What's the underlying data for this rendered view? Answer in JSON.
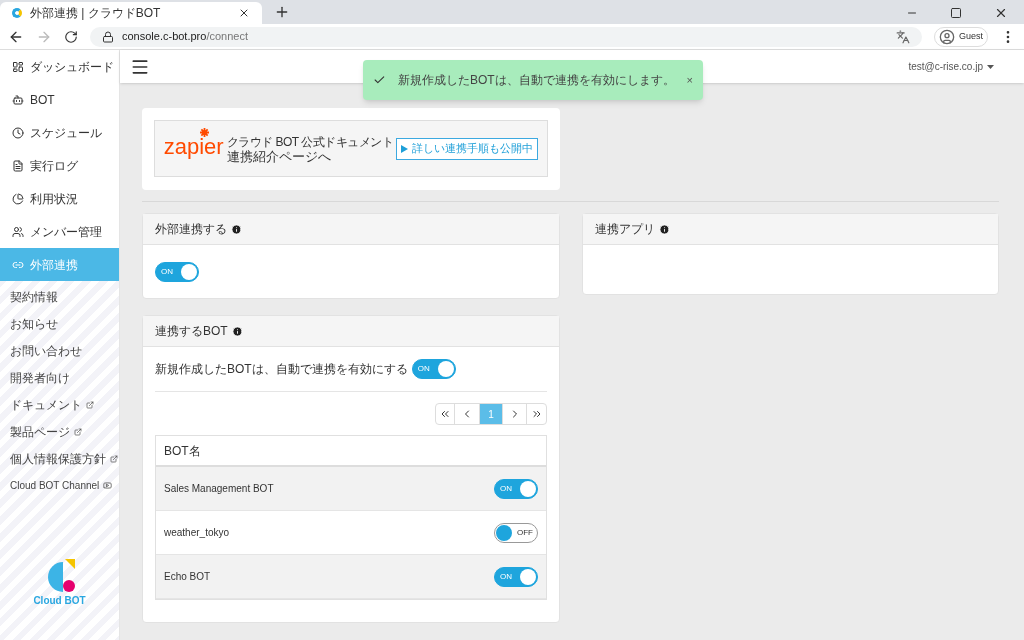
{
  "browser": {
    "tab_title": "外部連携 | クラウドBOT",
    "url_host": "console.c-bot.pro",
    "url_path": "/connect",
    "profile": "Guest"
  },
  "sidebar": {
    "items": [
      {
        "label": "ダッシュボード",
        "selected": false
      },
      {
        "label": "BOT",
        "selected": false
      },
      {
        "label": "スケジュール",
        "selected": false
      },
      {
        "label": "実行ログ",
        "selected": false
      },
      {
        "label": "利用状況",
        "selected": false
      },
      {
        "label": "メンバー管理",
        "selected": false
      },
      {
        "label": "外部連携",
        "selected": true
      }
    ],
    "links": [
      {
        "label": "契約情報",
        "kind": "plain"
      },
      {
        "label": "お知らせ",
        "kind": "plain"
      },
      {
        "label": "お問い合わせ",
        "kind": "plain"
      },
      {
        "label": "開発者向け",
        "kind": "plain"
      },
      {
        "label": "ドキュメント",
        "kind": "external"
      },
      {
        "label": "製品ページ",
        "kind": "external"
      },
      {
        "label": "個人情報保護方針",
        "kind": "external"
      },
      {
        "label": "Cloud BOT Channel",
        "kind": "video"
      }
    ],
    "logo_text": "Cloud BOT"
  },
  "topbar": {
    "user": "test@c-rise.co.jp"
  },
  "toast": {
    "message": "新規作成したBOTは、自動で連携を有効にします。",
    "close": "×"
  },
  "banner": {
    "brand": "zapier",
    "caption": "クラウド BOT 公式ドキュメント",
    "title": "連携紹介ページへ",
    "button": "詳しい連携手順も公開中"
  },
  "integration_card": {
    "title": "外部連携する",
    "toggle": {
      "on": true,
      "label": "ON"
    }
  },
  "apps_card": {
    "title": "連携アプリ"
  },
  "bots_card": {
    "title": "連携するBOT",
    "auto_label": "新規作成したBOTは、自動で連携を有効にする",
    "auto_toggle": {
      "on": true,
      "label": "ON"
    },
    "pages": [
      {
        "label": "1",
        "selected": true
      }
    ],
    "column": "BOT名",
    "rows": [
      {
        "name": "Sales Management BOT",
        "toggle": {
          "on": true,
          "label": "ON"
        }
      },
      {
        "name": "weather_tokyo",
        "toggle": {
          "on": false,
          "label": "OFF"
        }
      },
      {
        "name": "Echo BOT",
        "toggle": {
          "on": true,
          "label": "ON"
        }
      }
    ]
  }
}
